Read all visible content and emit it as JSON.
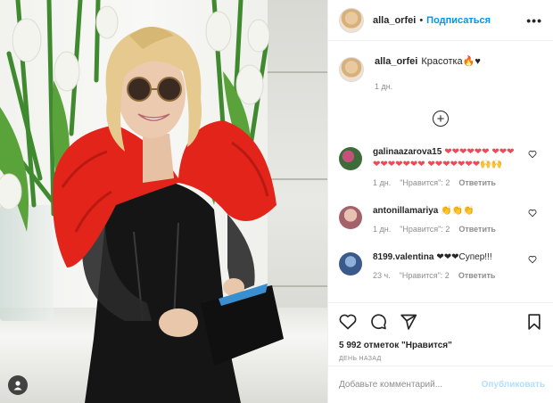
{
  "post": {
    "author": "alla_orfei",
    "follow_label": "Подписаться",
    "separator": "•",
    "more_label": "•••",
    "caption_text": "Красотка🔥♥",
    "caption_time": "1 дн.",
    "likes_text": "5 992 отметок \"Нравится\"",
    "date_text": "ДЕНЬ НАЗАД"
  },
  "comments": [
    {
      "user": "galinaazarova15",
      "text": "❤❤❤❤❤❤ ❤❤❤❤❤❤❤❤❤❤ ❤❤❤❤❤❤❤🙌🙌",
      "time": "1 дн.",
      "likes": "\"Нравится\": 2",
      "reply": "Ответить",
      "avatar_color": "#3d6b3a"
    },
    {
      "user": "antonillamariya",
      "text": "👏👏👏",
      "time": "1 дн.",
      "likes": "\"Нравится\": 2",
      "reply": "Ответить",
      "avatar_color": "#a3626a"
    },
    {
      "user": "8199.valentina",
      "text": "❤❤❤Супер!!!",
      "time": "23 ч.",
      "likes": "\"Нравится\": 2",
      "reply": "Ответить",
      "avatar_color": "#3a5a8c"
    }
  ],
  "add_comment": {
    "placeholder": "Добавьте комментарий...",
    "publish_label": "Опубликовать"
  },
  "colors": {
    "link": "#0095f6",
    "publish_disabled": "#b2dffc",
    "secondary_text": "#8e8e8e",
    "heart": "#ed4956"
  },
  "icons": [
    "user-profile-icon",
    "heart-icon",
    "comment-icon",
    "share-icon",
    "bookmark-icon",
    "plus-circle-icon"
  ]
}
